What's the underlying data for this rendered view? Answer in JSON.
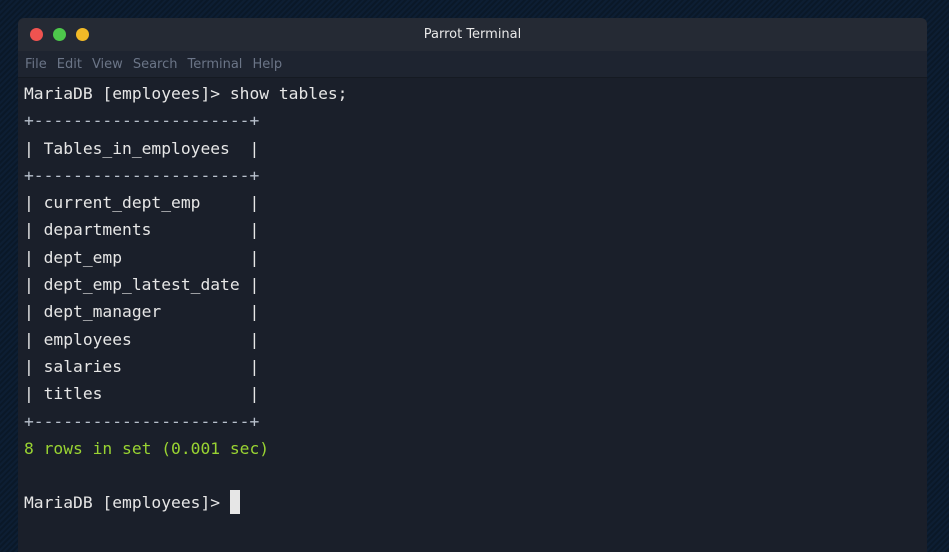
{
  "window": {
    "title": "Parrot Terminal"
  },
  "menu": [
    "File",
    "Edit",
    "View",
    "Search",
    "Terminal",
    "Help"
  ],
  "terminal": {
    "command_line": "MariaDB [employees]> show tables;",
    "border": "+----------------------+",
    "header": "| Tables_in_employees  |",
    "rows": [
      "| current_dept_emp     |",
      "| departments          |",
      "| dept_emp             |",
      "| dept_emp_latest_date |",
      "| dept_manager         |",
      "| employees            |",
      "| salaries             |",
      "| titles               |"
    ],
    "result": "8 rows in set (0.001 sec)",
    "blank": "",
    "prompt": "MariaDB [employees]> "
  },
  "colors": {
    "close": "#ef5350",
    "maximize": "#4dc84b",
    "minimize": "#f2ba27",
    "result_text": "#99d332"
  }
}
